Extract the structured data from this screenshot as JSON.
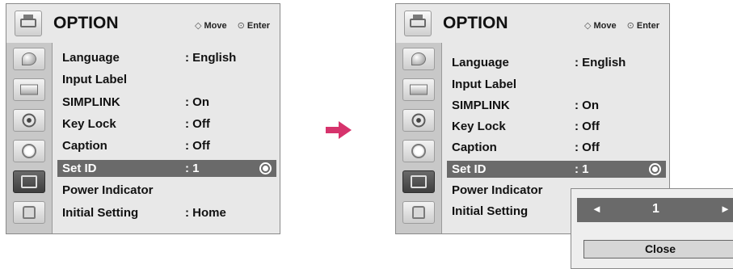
{
  "screens": [
    {
      "title": "OPTION",
      "move_label": "Move",
      "enter_label": "Enter",
      "items": [
        {
          "label": "Language",
          "value": ": English"
        },
        {
          "label": "Input Label",
          "value": ""
        },
        {
          "label": "SIMPLINK",
          "value": ": On"
        },
        {
          "label": "Key Lock",
          "value": ": Off"
        },
        {
          "label": "Caption",
          "value": ": Off"
        },
        {
          "label": "Set ID",
          "value": ": 1"
        },
        {
          "label": "Power Indicator",
          "value": ""
        },
        {
          "label": "Initial Setting",
          "value": ": Home"
        }
      ]
    },
    {
      "title": "OPTION",
      "move_label": "Move",
      "enter_label": "Enter",
      "items": [
        {
          "label": "Language",
          "value": ": English"
        },
        {
          "label": "Input Label",
          "value": ""
        },
        {
          "label": "SIMPLINK",
          "value": ": On"
        },
        {
          "label": "Key Lock",
          "value": ": Off"
        },
        {
          "label": "Caption",
          "value": ": Off"
        },
        {
          "label": "Set ID",
          "value": ": 1"
        },
        {
          "label": "Power Indicator",
          "value": ""
        },
        {
          "label": "Initial Setting",
          "value": ""
        }
      ]
    }
  ],
  "selected_item": "Set ID",
  "sidebar_icons": [
    "satellite-dish-icon",
    "picture-icon",
    "audio-icon",
    "clock-icon",
    "option-icon",
    "lock-icon"
  ],
  "active_sidebar_icon": "option-icon",
  "popup": {
    "value": "1",
    "left_arrow": "◄",
    "right_arrow": "►",
    "close_label": "Close"
  },
  "colors": {
    "highlight": "#6a6a6a",
    "arrow": "#d6336c",
    "panel_bg": "#e8e8e8"
  }
}
